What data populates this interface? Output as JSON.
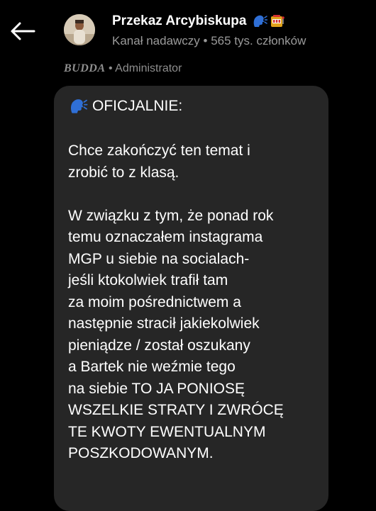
{
  "header": {
    "title": "Przekaz Arcybiskupa",
    "title_emojis": [
      "speaking-head-icon",
      "slot-machine-icon"
    ],
    "subtitle": "Kanał nadawczy • 565 tys. członków"
  },
  "sender": {
    "name": "BUDDA",
    "separator": "•",
    "role": "Administrator"
  },
  "message": {
    "heading": "OFICJALNIE:",
    "paragraph1": [
      "Chce zakończyć ten temat i",
      "zrobić to z klasą."
    ],
    "paragraph2": [
      "W związku z tym, że ponad rok",
      "temu oznaczałem instagrama",
      "MGP u siebie na socialach-",
      "jeśli ktokolwiek trafił tam",
      "za moim pośrednictwem a",
      "następnie stracił jakiekolwiek",
      "pieniądze / został oszukany",
      "a Bartek nie weźmie tego",
      "na siebie TO JA PONIOSĘ",
      "WSZELKIE STRATY I ZWRÓCĘ",
      "TE KWOTY EWENTUALNYM",
      "POSZKODOWANYM."
    ]
  },
  "colors": {
    "background": "#000000",
    "bubble": "#262626",
    "muted_text": "#9a9a9a",
    "emoji_blue": "#2f6fd6"
  }
}
